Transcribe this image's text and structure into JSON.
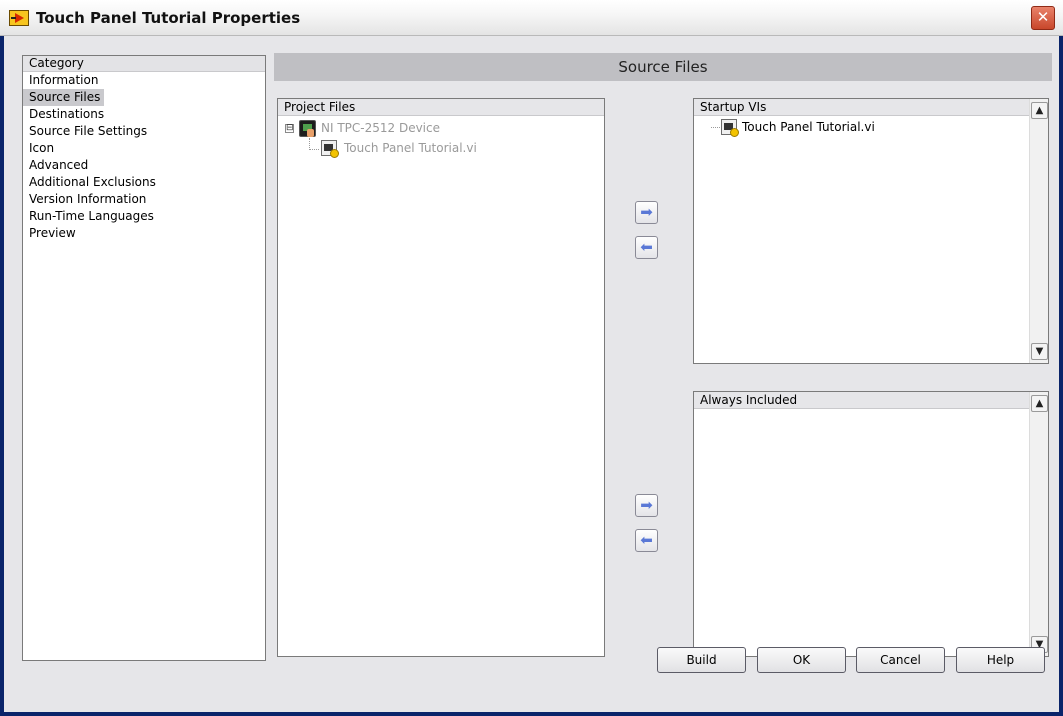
{
  "window": {
    "title": "Touch Panel Tutorial Properties",
    "close_glyph": "✕"
  },
  "category": {
    "header": "Category",
    "items": [
      "Information",
      "Source Files",
      "Destinations",
      "Source File Settings",
      "Icon",
      "Advanced",
      "Additional Exclusions",
      "Version Information",
      "Run-Time Languages",
      "Preview"
    ],
    "selected": "Source Files"
  },
  "section": {
    "title": "Source Files"
  },
  "project_files": {
    "header": "Project Files",
    "device": {
      "label": "NI TPC-2512 Device",
      "expander": "⊟",
      "icon": "touch-panel-device-icon"
    },
    "child": {
      "label": "Touch Panel Tutorial.vi",
      "icon": "vi-file-icon"
    }
  },
  "startup_vis": {
    "header": "Startup VIs",
    "items": [
      {
        "label": "Touch Panel Tutorial.vi",
        "icon": "vi-file-icon"
      }
    ]
  },
  "always_included": {
    "header": "Always Included",
    "items": []
  },
  "scroll": {
    "up": "▲",
    "down": "▼"
  },
  "arrows": {
    "add": "➡",
    "remove": "⬅"
  },
  "buttons": {
    "build": "Build",
    "ok": "OK",
    "cancel": "Cancel",
    "help": "Help"
  }
}
